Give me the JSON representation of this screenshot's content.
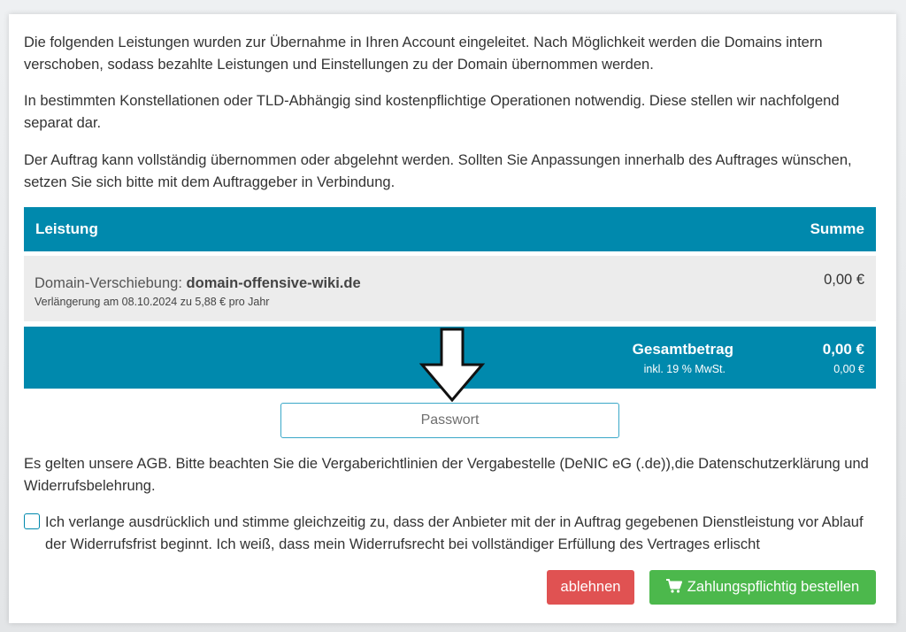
{
  "intro": {
    "paragraph1": "Die folgenden Leistungen wurden zur Übernahme in Ihren Account eingeleitet. Nach Möglichkeit werden die Domains intern verschoben, sodass bezahlte Leistungen und Einstellungen zu der Domain übernommen werden.",
    "paragraph2": "In bestimmten Konstellationen oder TLD-Abhängig sind kostenpflichtige Operationen notwendig. Diese stellen wir nachfolgend separat dar.",
    "paragraph3": "Der Auftrag kann vollständig übernommen oder abgelehnt werden. Sollten Sie Anpassungen innerhalb des Auftrages wünschen, setzen Sie sich bitte mit dem Auftraggeber in Verbindung."
  },
  "table": {
    "header_service": "Leistung",
    "header_sum": "Summe",
    "items": [
      {
        "type_label": "Domain-Verschiebung:",
        "domain": "domain-offensive-wiki.de",
        "renewal": "Verlängerung am 08.10.2024 zu 5,88 € pro Jahr",
        "price": "0,00 €"
      }
    ],
    "total_label": "Gesamtbetrag",
    "total_amount": "0,00 €",
    "vat_label": "inkl. 19 % MwSt.",
    "vat_amount": "0,00 €"
  },
  "password": {
    "placeholder": "Passwort"
  },
  "terms_text": "Es gelten unsere AGB. Bitte beachten Sie die Vergaberichtlinien der Vergabestelle (DeNIC eG (.de)),die Datenschutzerklärung und Widerrufsbelehrung.",
  "consent": {
    "checked": false,
    "text": "Ich verlange ausdrücklich und stimme gleichzeitig zu, dass der Anbieter mit der in Auftrag gegebenen Dienstleistung vor Ablauf der Widerrufsfrist beginnt. Ich weiß, dass mein Widerrufsrecht bei vollständiger Erfüllung des Vertrages erlischt"
  },
  "buttons": {
    "decline_label": "ablehnen",
    "order_label": "Zahlungspflichtig bestellen",
    "order_icon": "shopping-cart-icon"
  },
  "colors": {
    "primary": "#0089ad",
    "danger": "#e05252",
    "success": "#4cb84c",
    "row_bg": "#ececec"
  }
}
